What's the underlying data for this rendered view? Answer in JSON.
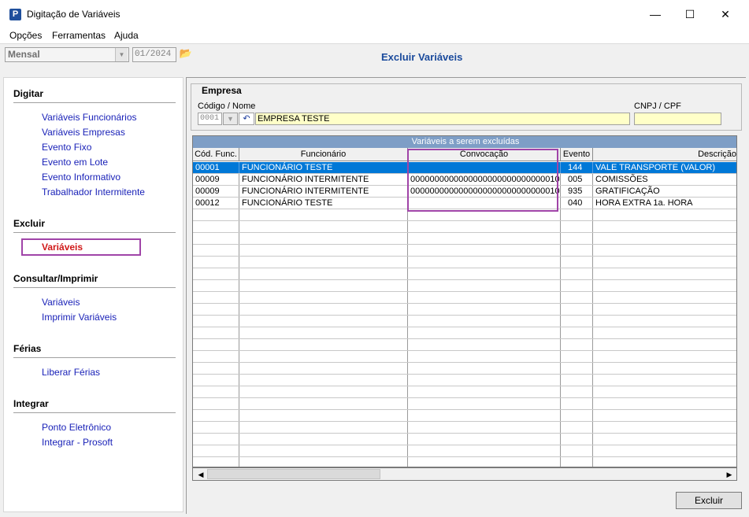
{
  "window": {
    "title": "Digitação de Variáveis",
    "app_icon": "P",
    "min": "—",
    "max": "☐",
    "close": "✕"
  },
  "menu": [
    "Opções",
    "Ferramentas",
    "Ajuda"
  ],
  "toolbar": {
    "period": "Mensal",
    "date": "01/2024",
    "heading": "Excluir Variáveis"
  },
  "sidebar": {
    "sections": [
      {
        "title": "Digitar",
        "items": [
          "Variáveis Funcionários",
          "Variáveis Empresas",
          "Evento Fixo",
          "Evento em Lote",
          "Evento Informativo",
          "Trabalhador Intermitente"
        ]
      },
      {
        "title": "Excluir",
        "items": [
          "Variáveis"
        ]
      },
      {
        "title": "Consultar/Imprimir",
        "items": [
          "Variáveis",
          "Imprimir Variáveis"
        ]
      },
      {
        "title": "Férias",
        "items": [
          "Liberar Férias"
        ]
      },
      {
        "title": "Integrar",
        "items": [
          "Ponto Eletrônico",
          "Integrar - Prosoft"
        ]
      }
    ],
    "active_color": "#d01818"
  },
  "empresa": {
    "group_label": "Empresa",
    "code_label": "Código / Nome",
    "cnpj_label": "CNPJ / CPF",
    "code": "0001",
    "name": "EMPRESA TESTE",
    "cnpj": ""
  },
  "grid": {
    "caption": "Variáveis a serem excluídas",
    "columns": [
      "Cód. Func.",
      "Funcionário",
      "Convocação",
      "Evento",
      "Descrição"
    ],
    "rows": [
      [
        "00001",
        "FUNCIONÁRIO TESTE",
        "",
        "144",
        "VALE TRANSPORTE (VALOR)"
      ],
      [
        "00009",
        "FUNCIONÁRIO INTERMITENTE",
        "0000000000000000000000000000010",
        "005",
        "COMISSÕES"
      ],
      [
        "00009",
        "FUNCIONÁRIO INTERMITENTE",
        "0000000000000000000000000000010",
        "935",
        "GRATIFICAÇÃO"
      ],
      [
        "00012",
        "FUNCIONÁRIO TESTE",
        "",
        "040",
        "HORA EXTRA 1a. HORA"
      ]
    ],
    "selected_row": 0,
    "selection_color": "#0078d7"
  },
  "buttons": {
    "delete": "Excluir"
  }
}
